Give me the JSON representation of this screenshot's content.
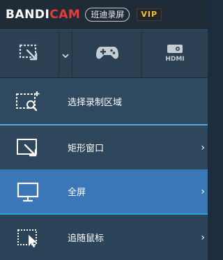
{
  "titlebar": {
    "brand_white": "BANDI",
    "brand_red": "CAM",
    "product_cn": "班迪录屏",
    "vip": "VIP"
  },
  "toolbar": {
    "items": [
      {
        "name": "screen-rect-mode",
        "icon": "rectangle-cursor-icon"
      },
      {
        "name": "mode-dropdown",
        "icon": "chevron-down-icon"
      },
      {
        "name": "game-mode",
        "icon": "gamepad-icon"
      },
      {
        "name": "device-mode",
        "icon": "hdmi-icon",
        "icon_text": "HDMI"
      }
    ]
  },
  "menu": {
    "items": [
      {
        "label": "选择录制区域",
        "icon": "select-region-icon",
        "has_submenu": false
      },
      {
        "label": "矩形窗口",
        "icon": "rectangle-window-icon",
        "has_submenu": true
      },
      {
        "label": "全屏",
        "icon": "monitor-icon",
        "has_submenu": true,
        "highlighted": true
      },
      {
        "label": "追随鼠标",
        "icon": "follow-mouse-icon",
        "has_submenu": true
      }
    ],
    "chevron": "›"
  },
  "colors": {
    "brand_red": "#e83c3c",
    "vip_gold": "#f4c430",
    "highlight": "#3b77b6",
    "menu_bg": "#2b4459"
  }
}
